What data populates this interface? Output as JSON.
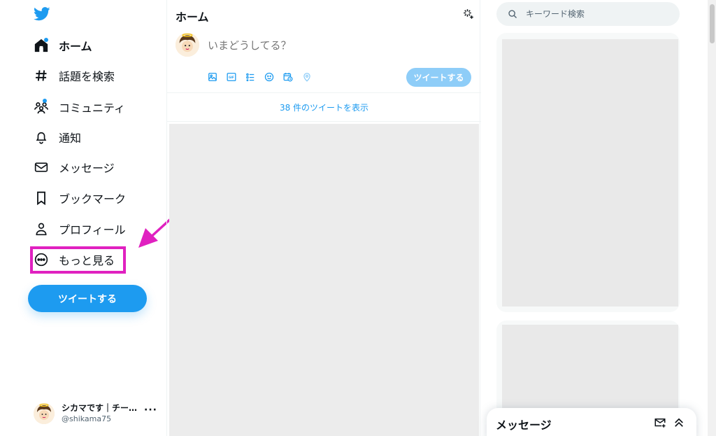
{
  "sidebar": {
    "nav": [
      {
        "label": "ホーム",
        "icon": "home-icon",
        "active": true
      },
      {
        "label": "話題を検索",
        "icon": "hashtag-icon"
      },
      {
        "label": "コミュニティ",
        "icon": "communities-icon"
      },
      {
        "label": "通知",
        "icon": "bell-icon"
      },
      {
        "label": "メッセージ",
        "icon": "envelope-icon"
      },
      {
        "label": "ブックマーク",
        "icon": "bookmark-icon"
      },
      {
        "label": "プロフィール",
        "icon": "profile-icon"
      },
      {
        "label": "もっと見る",
        "icon": "more-circle-icon"
      }
    ],
    "tweet_button": "ツイートする",
    "account": {
      "name": "シカマです｜チー…",
      "handle": "@shikama75",
      "more": "···"
    }
  },
  "main": {
    "title": "ホーム",
    "compose": {
      "placeholder": "いまどうしてる？",
      "tweet_button": "ツイートする",
      "tools": [
        "image-icon",
        "gif-icon",
        "poll-icon",
        "emoji-icon",
        "schedule-icon",
        "location-icon"
      ]
    },
    "show_new_tweets": "38 件のツイートを表示"
  },
  "right": {
    "search_placeholder": "キーワード検索"
  },
  "messages_drawer": {
    "title": "メッセージ"
  },
  "colors": {
    "accent": "#1d9bf0",
    "accent_disabled": "#8ecdf8",
    "highlight": "#e021c0",
    "text": "#0f1419",
    "muted": "#536471"
  }
}
